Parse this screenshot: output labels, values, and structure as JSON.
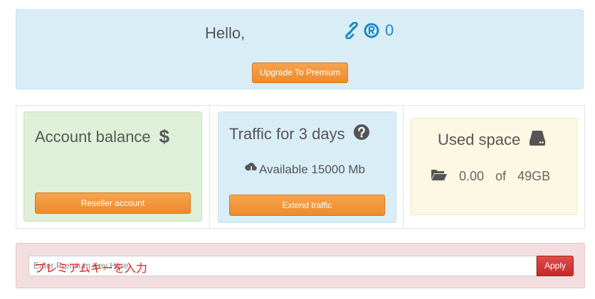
{
  "header": {
    "greeting": "Hello,",
    "points_value": "0",
    "link_icon": "link-icon",
    "points_icon": "registered-r-icon",
    "accent_color": "#1b8ac1",
    "upgrade_label": "Upgrade To Premium"
  },
  "cards": {
    "balance": {
      "title": "Account balance",
      "icon": "dollar-icon",
      "icon_glyph": "$",
      "button_label": "Reseller account"
    },
    "traffic": {
      "title": "Traffic for 3 days",
      "icon": "question-circle-icon",
      "available_icon": "cloud-download-icon",
      "available_text": "Available 15000 Mb",
      "button_label": "Extend traffic"
    },
    "space": {
      "title": "Used space",
      "icon": "hard-drive-icon",
      "folder_icon": "folder-open-icon",
      "used_value": "0.00",
      "of_label": "of",
      "total_value": "49GB"
    }
  },
  "premium": {
    "placeholder": "Enter Premium Key Here",
    "overlay_text": "プレミアムキーを入力",
    "apply_label": "Apply"
  },
  "colors": {
    "info_bg": "#d9edf7",
    "success_bg": "#dff0d8",
    "warning_bg": "#fcf8e3",
    "danger_bg": "#f2dede",
    "orange_button": "#f0902f",
    "red_button": "#d23b3b"
  }
}
